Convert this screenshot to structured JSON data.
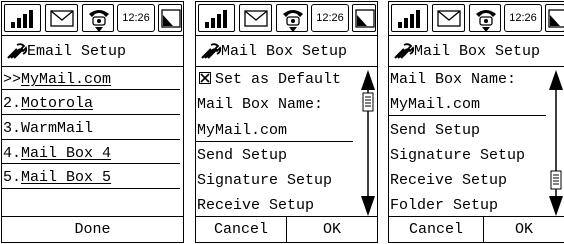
{
  "status_bar": {
    "time": "12:26",
    "icons": [
      "signal-bars-icon",
      "envelope-icon",
      "telephone-icon",
      "battery-icon"
    ]
  },
  "screens": [
    {
      "title": "Email Setup",
      "items": [
        {
          "prefix": ">>",
          "label": "MyMail.com",
          "selected": true
        },
        {
          "prefix": "2.",
          "label": "Motorola"
        },
        {
          "prefix": "3.",
          "label": "WarmMail"
        },
        {
          "prefix": "4.",
          "label": "Mail Box 4"
        },
        {
          "prefix": "5.",
          "label": "Mail Box 5"
        }
      ],
      "buttons": [
        "Done"
      ]
    },
    {
      "title": "Mail Box Setup",
      "checkbox_label": "Set as Default",
      "checkbox_checked": true,
      "name_label": "Mail Box Name:",
      "name_value": "MyMail.com",
      "items": [
        "Send Setup",
        "Signature Setup",
        "Receive Setup"
      ],
      "buttons": [
        "Cancel",
        "OK"
      ]
    },
    {
      "title": "Mail Box Setup",
      "name_label": "Mail Box Name:",
      "name_value": "MyMail.com",
      "items": [
        "Send Setup",
        "Signature Setup",
        "Receive Setup",
        "Folder Setup"
      ],
      "buttons": [
        "Cancel",
        "OK"
      ]
    }
  ]
}
